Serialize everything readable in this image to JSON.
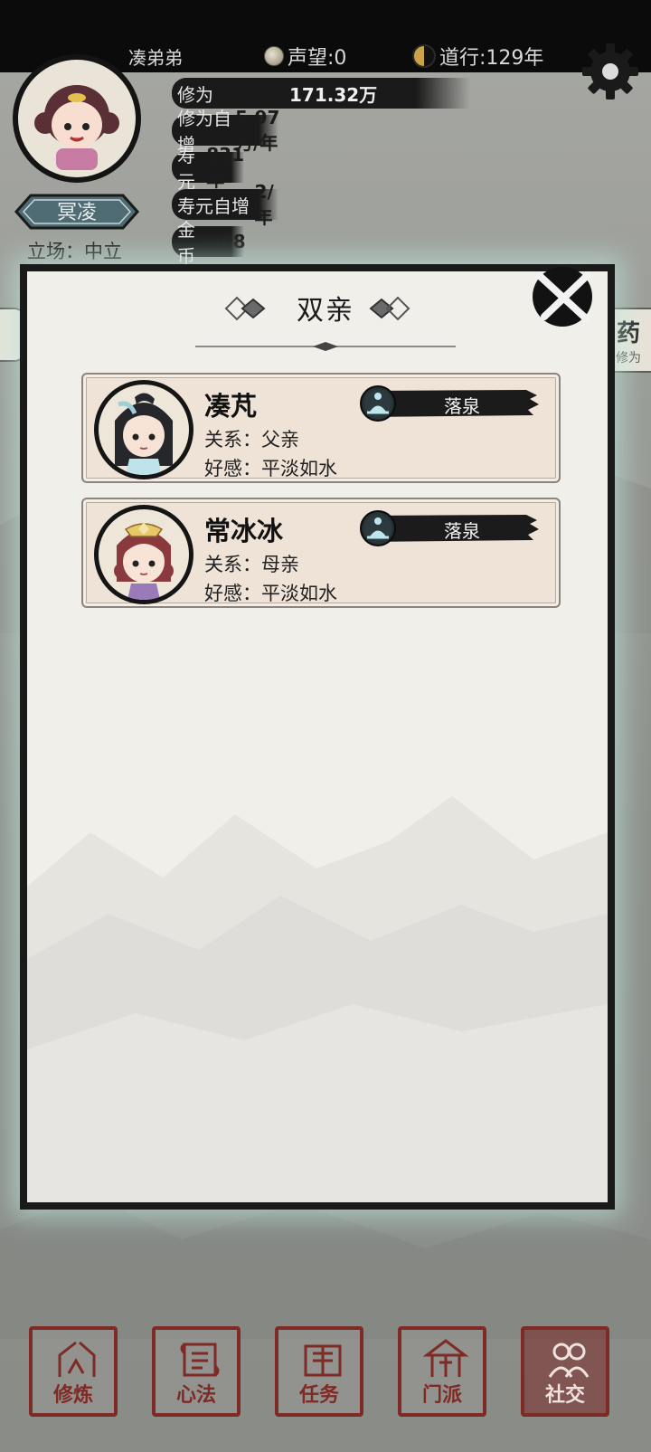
{
  "header": {
    "player_name": "凑弟弟",
    "reputation": "声望:0",
    "daoxing": "道行:129年"
  },
  "profile": {
    "title_badge": "冥凌",
    "stance": "立场：中立",
    "stats": [
      {
        "label": "修为",
        "value": "171.32万"
      },
      {
        "label": "修为自增",
        "value": "5.97万/年"
      },
      {
        "label": "寿元",
        "value": "831年"
      },
      {
        "label": "寿元自增",
        "value": "2/年"
      },
      {
        "label": "金币",
        "value": "5608"
      }
    ],
    "side_button": {
      "label": "药",
      "sub": "修为"
    }
  },
  "modal": {
    "title": "双亲",
    "relatives": [
      {
        "name": "凑芃",
        "relation": "关系：父亲",
        "affinity": "好感：平淡如水",
        "realm": "落泉",
        "gender": "male"
      },
      {
        "name": "常冰冰",
        "relation": "关系：母亲",
        "affinity": "好感：平淡如水",
        "realm": "落泉",
        "gender": "female"
      }
    ]
  },
  "nav": [
    {
      "label": "修炼",
      "active": false
    },
    {
      "label": "心法",
      "active": false
    },
    {
      "label": "任务",
      "active": false
    },
    {
      "label": "门派",
      "active": false
    },
    {
      "label": "社交",
      "active": true
    }
  ],
  "colors": {
    "accent_red": "#7e2a25",
    "panel_bg": "#f1efea",
    "card_bg": "#efe2d6",
    "glow": "#bee6dc"
  }
}
